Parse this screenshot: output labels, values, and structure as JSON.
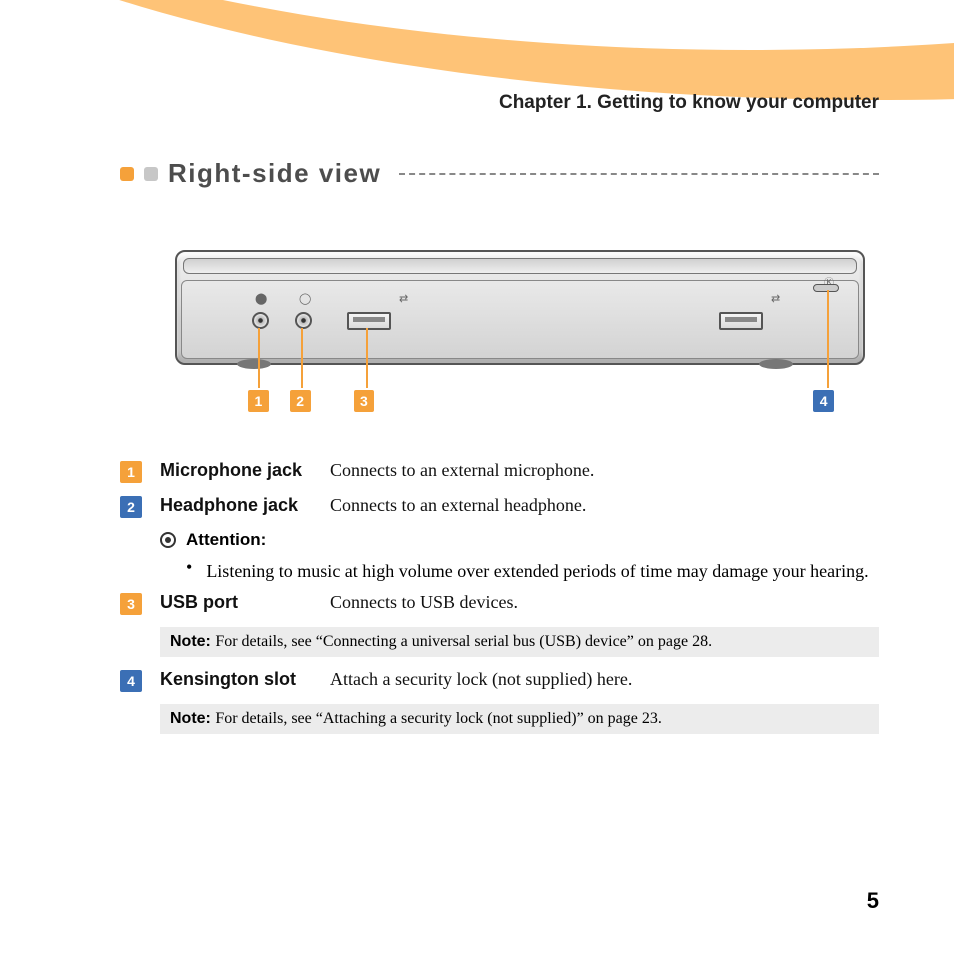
{
  "chapter": "Chapter 1. Getting to know your computer",
  "section_title": "Right-side view",
  "callouts": [
    "1",
    "2",
    "3",
    "4"
  ],
  "items": [
    {
      "num": "1",
      "term": "Microphone jack",
      "desc": "Connects to an external microphone."
    },
    {
      "num": "2",
      "term": "Headphone jack",
      "desc": "Connects to an external headphone."
    }
  ],
  "attention": {
    "label": "Attention:",
    "bullet": "Listening to music at high volume over extended periods of time may damage your hearing."
  },
  "items2": [
    {
      "num": "3",
      "term": "USB port",
      "desc": "Connects to USB devices.",
      "note": "For details, see “Connecting a universal serial bus (USB) device” on page 28."
    },
    {
      "num": "4",
      "term": "Kensington slot",
      "desc": "Attach a security lock (not supplied) here.",
      "note": "For details, see “Attaching a security lock (not supplied)” on page 23."
    }
  ],
  "note_label": "Note: ",
  "page_number": "5",
  "glyphs": {
    "mic": "⬤",
    "hp": "◯",
    "usb": "⇄",
    "k": "Ⓚ"
  }
}
